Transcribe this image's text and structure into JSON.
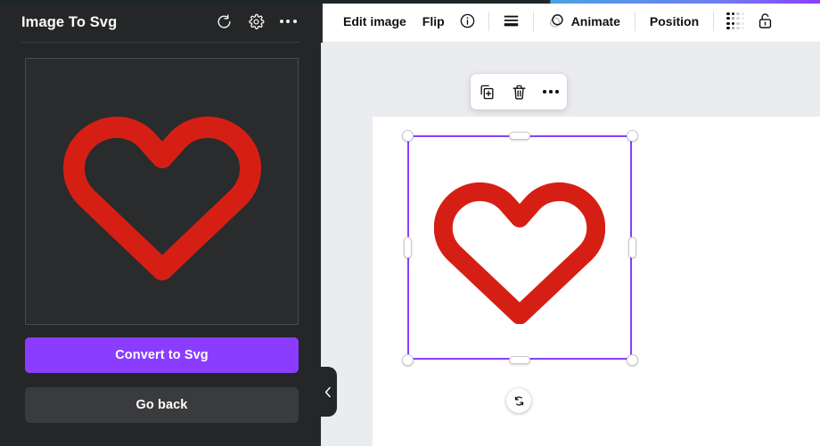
{
  "app": {
    "accent_purple": "#8b3dff",
    "heart_red": "#d61f14",
    "panel_bg": "#252627",
    "canvas_bg": "#ebecf0"
  },
  "side_panel": {
    "title": "Image To Svg",
    "header_icons": [
      {
        "name": "refresh-icon",
        "label": "Refresh"
      },
      {
        "name": "settings-gear-icon",
        "label": "Settings"
      },
      {
        "name": "more-options-icon",
        "label": "More options"
      }
    ],
    "preview": {
      "name": "image-preview",
      "alt": "Red heart outline"
    },
    "primary_button": "Convert to Svg",
    "secondary_button": "Go back",
    "collapse_label": "Collapse panel"
  },
  "toolbar": {
    "items": [
      {
        "id": "edit-image",
        "label": "Edit image",
        "icon": null
      },
      {
        "id": "flip",
        "label": "Flip",
        "icon": null
      },
      {
        "id": "info",
        "label": "",
        "icon": "info-circle-icon"
      },
      {
        "id": "divider1",
        "label": "",
        "icon": "divider"
      },
      {
        "id": "layers",
        "label": "",
        "icon": "layers-bars-icon"
      },
      {
        "id": "divider2",
        "label": "",
        "icon": "divider"
      },
      {
        "id": "animate",
        "label": "Animate",
        "icon": "animate-circles-icon"
      },
      {
        "id": "divider3",
        "label": "",
        "icon": "divider"
      },
      {
        "id": "position",
        "label": "Position",
        "icon": null
      },
      {
        "id": "divider4",
        "label": "",
        "icon": "divider"
      },
      {
        "id": "transparency",
        "label": "",
        "icon": "transparency-dots-icon"
      },
      {
        "id": "lock",
        "label": "",
        "icon": "unlocked-padlock-icon"
      }
    ]
  },
  "context_toolbar": {
    "buttons": [
      {
        "id": "duplicate",
        "icon": "duplicate-icon",
        "label": "Duplicate"
      },
      {
        "id": "delete",
        "icon": "trash-icon",
        "label": "Delete"
      },
      {
        "id": "more",
        "icon": "more-options-icon",
        "label": "More"
      }
    ]
  },
  "canvas": {
    "element_name": "heart-graphic",
    "selection_label": "Selected element",
    "rotate_label": "Rotate"
  }
}
